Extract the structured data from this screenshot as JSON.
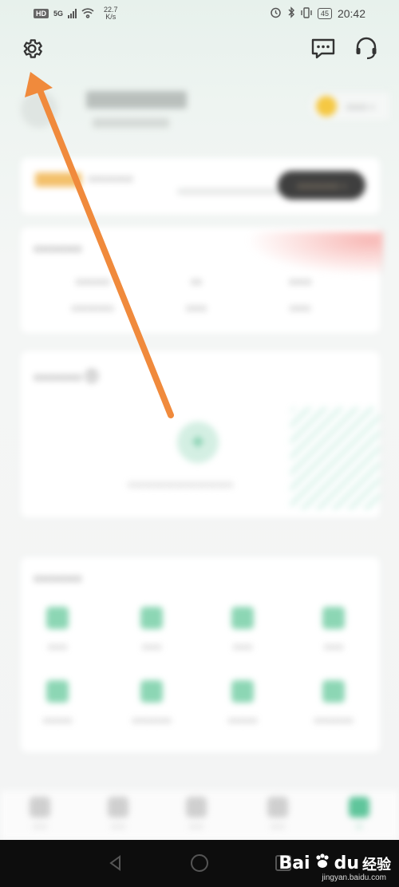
{
  "status_bar": {
    "hd": "HD",
    "network_type": "5G",
    "net_speed_value": "22.7",
    "net_speed_unit": "K/s",
    "battery": "45",
    "time": "20:42"
  },
  "header": {
    "settings_icon": "gear-icon",
    "message_icon": "chat-bubble-icon",
    "service_icon": "headset-icon"
  },
  "colors": {
    "accent_green": "#47b887",
    "arrow_orange": "#f08a3c",
    "coin_yellow": "#f5c843"
  },
  "tools": [
    {
      "icon": "tool-icon-1"
    },
    {
      "icon": "tool-icon-2"
    },
    {
      "icon": "tool-icon-3"
    },
    {
      "icon": "tool-icon-4"
    },
    {
      "icon": "tool-icon-5"
    },
    {
      "icon": "tool-icon-6"
    },
    {
      "icon": "tool-icon-7"
    },
    {
      "icon": "tool-icon-8"
    }
  ],
  "watermark": {
    "brand": "Bai",
    "brand_suffix": "du",
    "product": "经验",
    "url": "jingyan.baidu.com"
  }
}
